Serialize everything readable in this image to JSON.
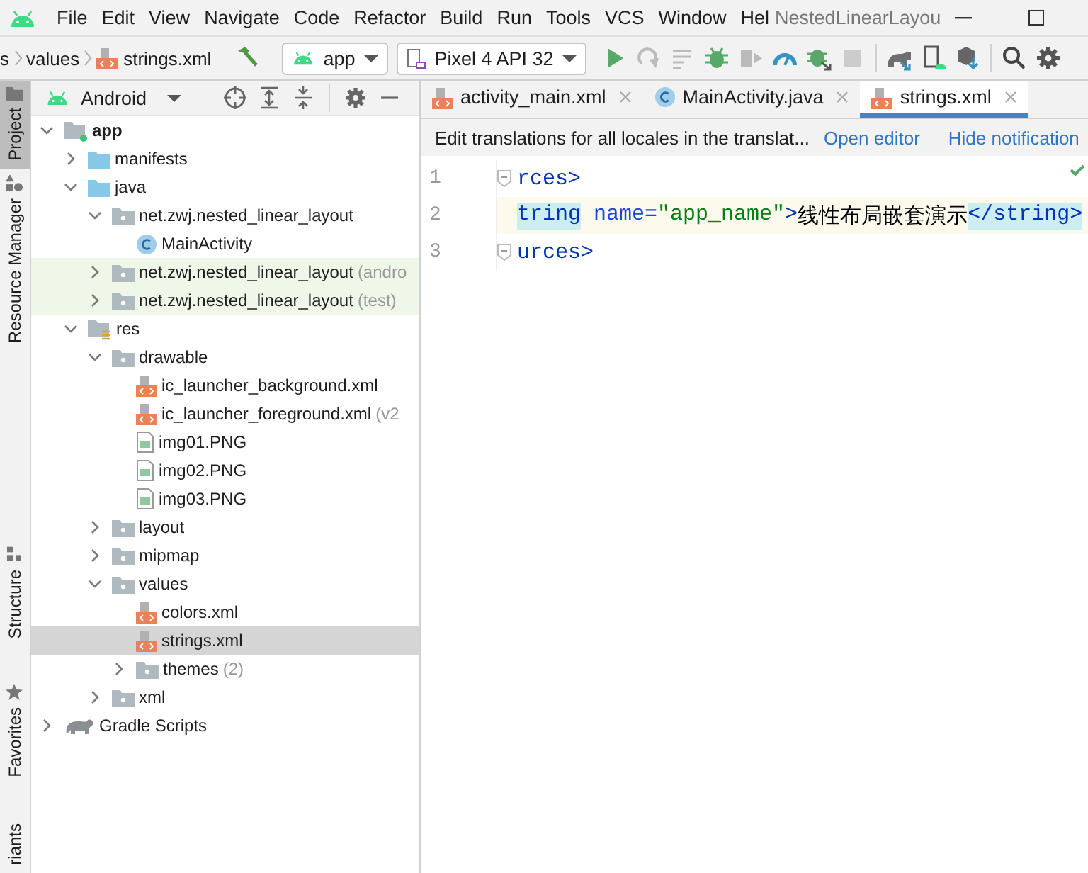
{
  "menu_bar": {
    "items": [
      "File",
      "Edit",
      "View",
      "Navigate",
      "Code",
      "Refactor",
      "Build",
      "Run",
      "Tools",
      "VCS",
      "Window",
      "Hel"
    ],
    "title": "NestedLinearLayou"
  },
  "toolbar": {
    "breadcrumbs": [
      {
        "label": "s",
        "kind": "folder"
      },
      {
        "label": "values",
        "kind": "folder"
      },
      {
        "label": "strings.xml",
        "kind": "xml"
      }
    ],
    "run_config": "app",
    "device": "Pixel 4 API 32"
  },
  "side_stripe": {
    "top": [
      {
        "label": "Project",
        "selected": true
      },
      {
        "label": "Resource Manager",
        "selected": false
      }
    ],
    "bottom": [
      {
        "label": "Structure",
        "selected": false
      },
      {
        "label": "Favorites",
        "selected": false
      },
      {
        "label": "riants",
        "selected": false
      }
    ]
  },
  "project_panel": {
    "view": "Android",
    "tree": [
      {
        "label": "app",
        "kind": "module",
        "bold": true,
        "expanded": true,
        "children": [
          {
            "label": "manifests",
            "kind": "folder",
            "expanded": false
          },
          {
            "label": "java",
            "kind": "folder",
            "expanded": true,
            "children": [
              {
                "label": "net.zwj.nested_linear_layout",
                "kind": "package",
                "expanded": true,
                "children": [
                  {
                    "label": "MainActivity",
                    "kind": "class"
                  }
                ]
              },
              {
                "label": "net.zwj.nested_linear_layout",
                "hint": "(andro",
                "kind": "package",
                "expanded": false,
                "highlighted": true
              },
              {
                "label": "net.zwj.nested_linear_layout",
                "hint": "(test)",
                "kind": "package",
                "expanded": false,
                "highlighted": true
              }
            ]
          },
          {
            "label": "res",
            "kind": "res",
            "expanded": true,
            "children": [
              {
                "label": "drawable",
                "kind": "package",
                "expanded": true,
                "children": [
                  {
                    "label": "ic_launcher_background.xml",
                    "kind": "xml"
                  },
                  {
                    "label": "ic_launcher_foreground.xml",
                    "hint": "(v2",
                    "kind": "xml"
                  },
                  {
                    "label": "img01.PNG",
                    "kind": "image"
                  },
                  {
                    "label": "img02.PNG",
                    "kind": "image"
                  },
                  {
                    "label": "img03.PNG",
                    "kind": "image"
                  }
                ]
              },
              {
                "label": "layout",
                "kind": "package",
                "expanded": false
              },
              {
                "label": "mipmap",
                "kind": "package",
                "expanded": false
              },
              {
                "label": "values",
                "kind": "package",
                "expanded": true,
                "children": [
                  {
                    "label": "colors.xml",
                    "kind": "xml",
                    "selected": false
                  },
                  {
                    "label": "strings.xml",
                    "kind": "xml",
                    "selected": true
                  },
                  {
                    "label": "themes",
                    "hint": "(2)",
                    "kind": "package",
                    "expanded": false
                  }
                ]
              },
              {
                "label": "xml",
                "kind": "package",
                "expanded": false
              }
            ]
          }
        ]
      },
      {
        "label": "Gradle Scripts",
        "kind": "gradle",
        "expanded": false
      }
    ]
  },
  "editor": {
    "tabs": [
      {
        "label": "activity_main.xml",
        "kind": "xml",
        "selected": false
      },
      {
        "label": "MainActivity.java",
        "kind": "class",
        "selected": false
      },
      {
        "label": "strings.xml",
        "kind": "xml",
        "selected": true
      }
    ],
    "notification": {
      "message": "Edit translations for all locales in the translat...",
      "links": [
        "Open editor",
        "Hide notification"
      ]
    },
    "lines": [
      {
        "number": "1",
        "current": false,
        "fold": true,
        "segments": [
          {
            "text": "rces>",
            "kind": "tag",
            "matched": false
          }
        ]
      },
      {
        "number": "2",
        "current": true,
        "fold": false,
        "segments": [
          {
            "text": "tring",
            "kind": "tag",
            "matched": true
          },
          {
            "text": " name=",
            "kind": "attr",
            "matched": false
          },
          {
            "text": "\"app_name\"",
            "kind": "value",
            "matched": false
          },
          {
            "text": ">",
            "kind": "tag",
            "matched": false
          },
          {
            "text": "线性布局嵌套演示",
            "kind": "text",
            "matched": false
          },
          {
            "text": "</string>",
            "kind": "tag",
            "matched": true
          }
        ]
      },
      {
        "number": "3",
        "current": false,
        "fold": true,
        "segments": [
          {
            "text": "urces>",
            "kind": "tag",
            "matched": false
          }
        ]
      }
    ]
  }
}
